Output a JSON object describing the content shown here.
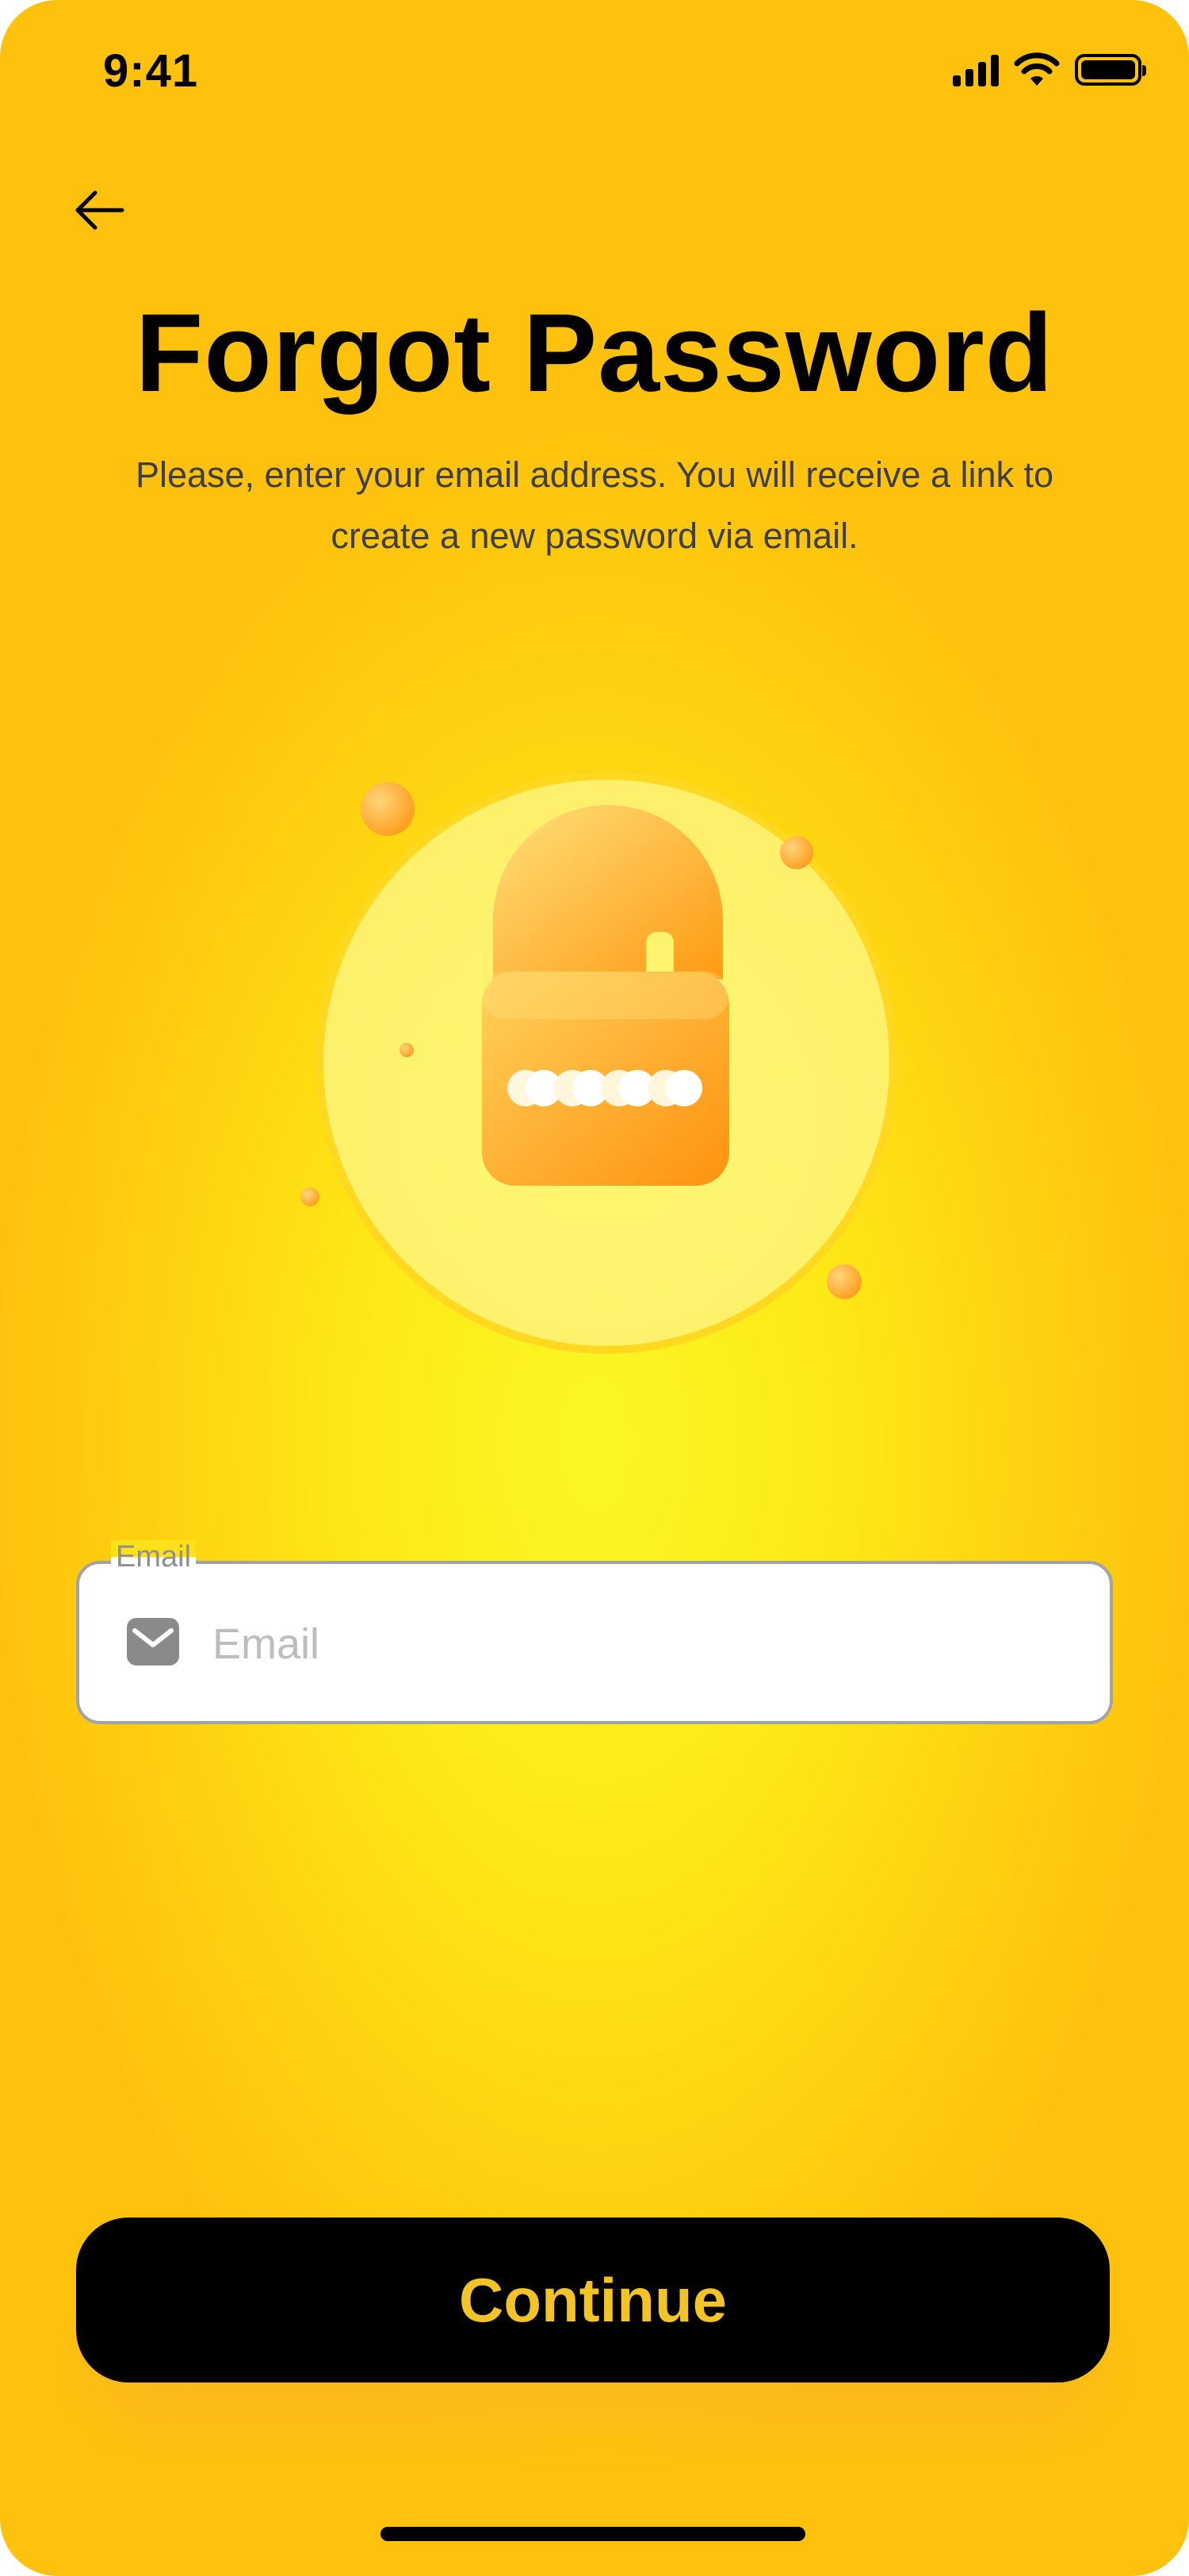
{
  "status_bar": {
    "time": "9:41",
    "signal_icon": "cellular-signal-icon",
    "wifi_icon": "wifi-icon",
    "battery_icon": "battery-icon"
  },
  "header": {
    "back_icon": "arrow-left-icon",
    "title": "Forgot Password",
    "subtitle": "Please, enter your email address. You will receive a link to create a new password via email."
  },
  "illustration": {
    "icon": "padlock-icon"
  },
  "form": {
    "email": {
      "label": "Email",
      "placeholder": "Email",
      "value": "",
      "icon": "envelope-icon"
    }
  },
  "actions": {
    "continue_label": "Continue"
  },
  "colors": {
    "background": "#FED30F",
    "accent": "#FBF724",
    "button_background": "#000000",
    "button_text": "#F3C428",
    "padlock": "#FFA51A"
  }
}
